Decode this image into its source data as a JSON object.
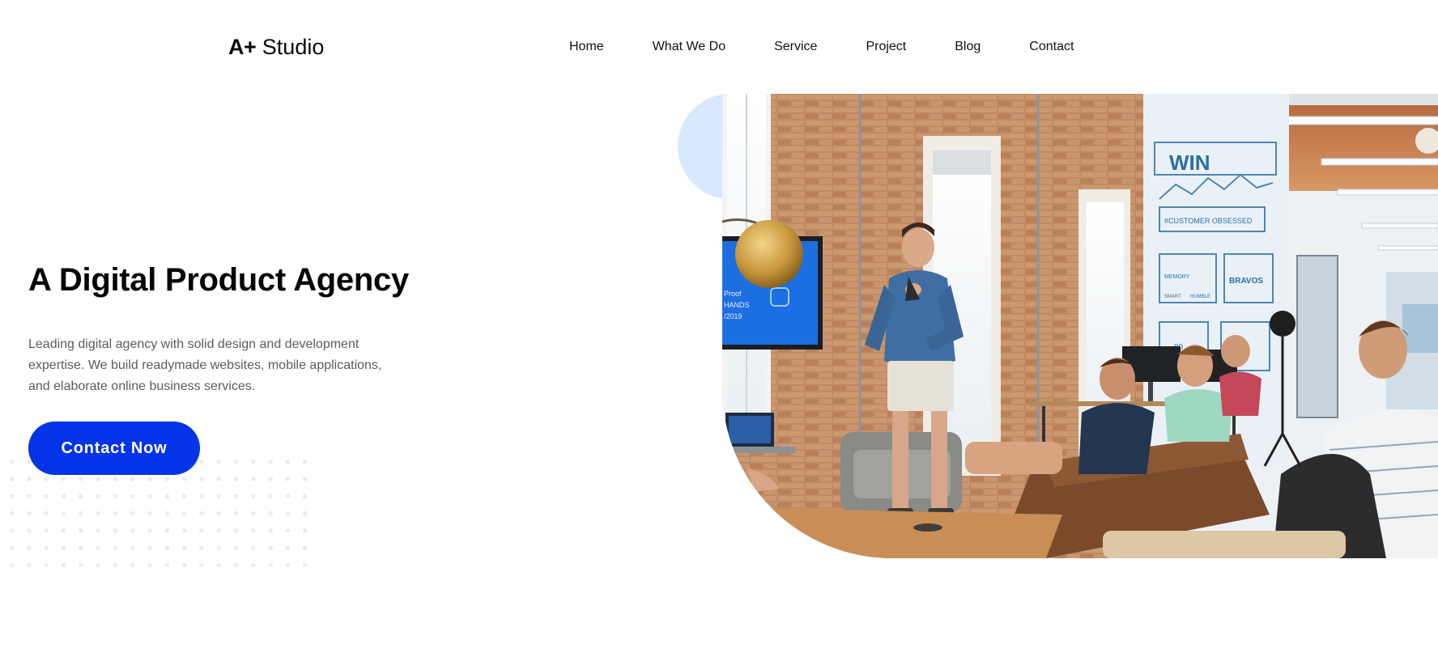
{
  "header": {
    "logo": {
      "mark": "A+",
      "word": "Studio"
    },
    "nav": [
      {
        "label": "Home"
      },
      {
        "label": "What We Do"
      },
      {
        "label": "Service"
      },
      {
        "label": "Project"
      },
      {
        "label": "Blog"
      },
      {
        "label": "Contact"
      }
    ]
  },
  "hero": {
    "title": "A Digital Product Agency",
    "description": "Leading digital agency with solid design and development expertise. We build readymade websites, mobile applications, and elaborate online business services.",
    "cta_label": "Contact Now"
  },
  "photo": {
    "screen_text_1": "Proof",
    "screen_text_2": "HANDS",
    "screen_text_3": "/2019",
    "wall_win": "WIN",
    "wall_tag": "#CUSTOMER OBSESSED",
    "wall_box": "BRAVOS",
    "wall_num": "80",
    "wall_word_1": "MEMORY",
    "wall_word_2": "SMART",
    "wall_word_3": "HUMBLE"
  },
  "colors": {
    "accent": "#0534e8",
    "bubble": "#d7e8ff",
    "body_text": "#5c5c5c"
  }
}
